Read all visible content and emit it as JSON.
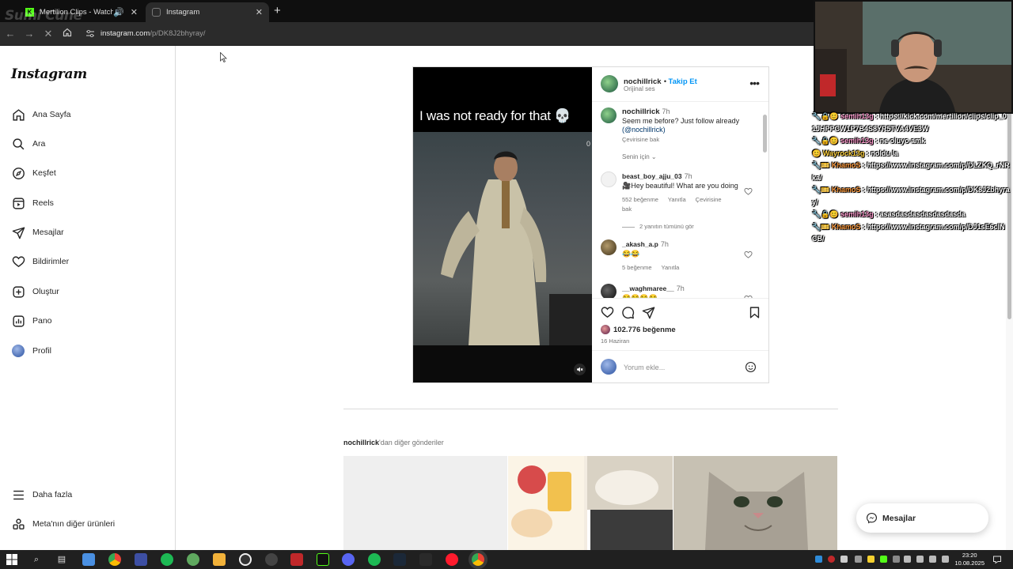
{
  "browser": {
    "watermark": "Sumi Cune",
    "tabs": [
      {
        "title": "Mertilion Clips - Watch Live"
      },
      {
        "title": "Instagram"
      }
    ],
    "url_host": "instagram.com",
    "url_path": "/p/DK8J2bhyray/"
  },
  "instagram": {
    "logo": "Instagram",
    "nav": [
      {
        "label": "Ana Sayfa",
        "icon": "home-icon"
      },
      {
        "label": "Ara",
        "icon": "search-icon"
      },
      {
        "label": "Keşfet",
        "icon": "compass-icon"
      },
      {
        "label": "Reels",
        "icon": "reels-icon"
      },
      {
        "label": "Mesajlar",
        "icon": "send-icon"
      },
      {
        "label": "Bildirimler",
        "icon": "heart-icon"
      },
      {
        "label": "Oluştur",
        "icon": "plus-icon"
      },
      {
        "label": "Pano",
        "icon": "chart-icon"
      },
      {
        "label": "Profil",
        "icon": "profile-avatar-icon"
      }
    ],
    "more_label": "Daha fazla",
    "meta_label": "Meta'nın diğer ürünleri",
    "post": {
      "video_caption": "I was not ready for that 💀",
      "video_counter": "0",
      "author": "nochillrick",
      "follow_label": "Takip Et",
      "audio": "Orijinal ses",
      "caption_user": "nochillrick",
      "caption_time": "7h",
      "caption_text": "Seem me before? Just follow already",
      "caption_mention": "(@nochillrick)",
      "caption_translate": "Çevirisine bak",
      "for_you": "Senin için",
      "comments": [
        {
          "user": "beast_boy_ajju_03",
          "time": "7h",
          "text": "🎥Hey beautiful! What are you doing",
          "likes": "552 beğenme",
          "reply": "Yanıtla",
          "translate": "Çevirisine bak",
          "replies": "2 yanıtın tümünü gör"
        },
        {
          "user": "_akash_a.p",
          "time": "7h",
          "text": "😂😂",
          "likes": "5 beğenme",
          "reply": "Yanıtla"
        },
        {
          "user": "__waghmaree__",
          "time": "7h",
          "text": "😂😂😂😂"
        }
      ],
      "like_count": "102.776 beğenme",
      "date": "16 Haziran",
      "comment_placeholder": "Yorum ekle..."
    },
    "more_posts_user": "nochillrick",
    "more_posts_suffix": "'dan diğer gönderiler",
    "messages_button": "Mesajlar"
  },
  "chat": [
    {
      "user": "semih13g",
      "text": "https://kick.com/mertilion/clips/clip_01JHPPCW1P7B4S8YR5TVA4VE3W",
      "color": "#ff9ccf"
    },
    {
      "user": "semih13g",
      "text": "ne oluyo amk",
      "color": "#ff9ccf"
    },
    {
      "user": "Wayrock13g",
      "text": "noldu la",
      "color": "#ffd23f"
    },
    {
      "user": "KhamoS",
      "text": "https://www.instagram.com/p/DLZKQ_rNRka/",
      "color": "#ff9c3f"
    },
    {
      "user": "KhamoS",
      "text": "https://www.instagram.com/p/DK8J2bhyray/",
      "color": "#ff9c3f"
    },
    {
      "user": "semih13g",
      "text": "asasdasdasdasdasdasda",
      "color": "#ff9ccf"
    },
    {
      "user": "KhamoS",
      "text": "https://www.instagram.com/p/DJ1sE6cINCB/",
      "color": "#ff9c3f"
    }
  ],
  "taskbar": {
    "time": "23:20",
    "date": "10.08.2025"
  },
  "colors": {
    "instagram_blue": "#0095f6",
    "chrome_dark": "#2b2b2b"
  }
}
